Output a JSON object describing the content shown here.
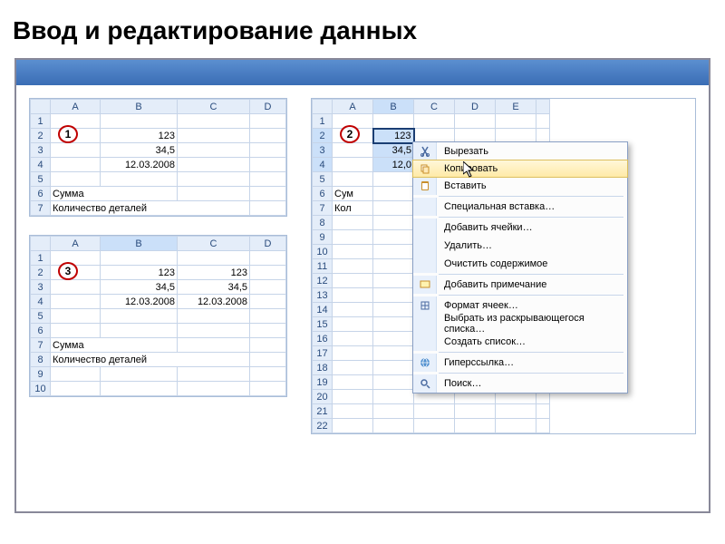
{
  "title": "Ввод и редактирование данных",
  "callouts": {
    "c1": "1",
    "c2": "2",
    "c3": "3"
  },
  "columns": [
    "A",
    "B",
    "C",
    "D",
    "E"
  ],
  "sheet1": {
    "rows": [
      "1",
      "2",
      "3",
      "4",
      "5",
      "6",
      "7"
    ],
    "B2": "123",
    "B3": "34,5",
    "B4": "12.03.2008",
    "A6": "Сумма",
    "A7": "Количество деталей"
  },
  "sheet2": {
    "rows": [
      "1",
      "2",
      "3",
      "4",
      "5",
      "6",
      "7",
      "8",
      "9",
      "10",
      "11",
      "12",
      "13",
      "14",
      "15",
      "16",
      "17",
      "18",
      "19",
      "20",
      "21",
      "22"
    ],
    "B2": "123",
    "B3": "34,5",
    "B4partial": "12,0",
    "A6": "Сум",
    "A7": "Кол"
  },
  "sheet3": {
    "rows": [
      "1",
      "2",
      "3",
      "4",
      "5",
      "6",
      "7",
      "8",
      "9",
      "10"
    ],
    "B2": "123",
    "C2": "123",
    "B3": "34,5",
    "C3": "34,5",
    "B4": "12.03.2008",
    "C4": "12.03.2008",
    "A7": "Сумма",
    "A8": "Количество деталей"
  },
  "contextMenu": {
    "cut": "Вырезать",
    "copy": "Копировать",
    "paste": "Вставить",
    "pasteSpecial": "Специальная вставка…",
    "insertCells": "Добавить ячейки…",
    "delete": "Удалить…",
    "clear": "Очистить содержимое",
    "addComment": "Добавить примечание",
    "formatCells": "Формат ячеек…",
    "dropdown": "Выбрать из раскрывающегося списка…",
    "createList": "Создать список…",
    "hyperlink": "Гиперссылка…",
    "find": "Поиск…"
  }
}
